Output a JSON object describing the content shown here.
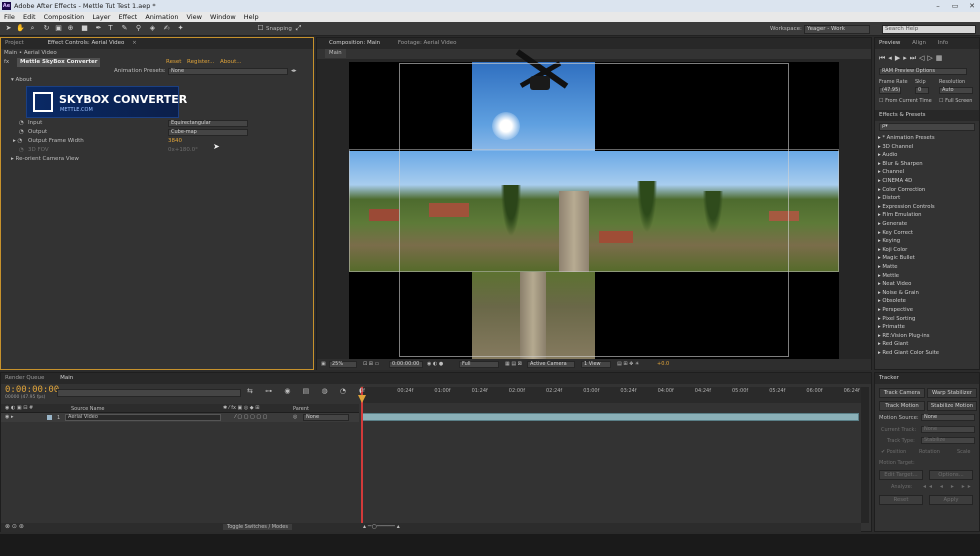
{
  "app": {
    "title": "Adobe After Effects - Mettle Tut Test 1.aep *",
    "logo": "Ae"
  },
  "menu": [
    "File",
    "Edit",
    "Composition",
    "Layer",
    "Effect",
    "Animation",
    "View",
    "Window",
    "Help"
  ],
  "toolbar": {
    "snapping": "Snapping",
    "workspace_label": "Workspace:",
    "workspace_value": "Yeager - Work",
    "search_placeholder": "Search Help"
  },
  "left_panel": {
    "tabs": [
      "Project",
      "Effect Controls: Aerial Video"
    ],
    "breadcrumb": "Main • Aerial Video",
    "effect_name": "Mettle SkyBox Converter",
    "reset": "Reset",
    "register": "Register...",
    "about_link": "About...",
    "animation_presets_label": "Animation Presets:",
    "animation_presets_value": "None",
    "about": "About",
    "logo_text": "SKYBOX CONVERTER",
    "logo_sub": "METTLE.COM",
    "input_label": "Input",
    "input_value": "Equirectangular",
    "output_label": "Output",
    "output_value": "Cube-map",
    "width_label": "Output Frame Width",
    "width_value": "3840",
    "fov_label": "3D FOV",
    "fov_value": "0x+180.0°",
    "camera_label": "Re-orient Camera View"
  },
  "comp_panel": {
    "tabs": [
      "Composition: Main",
      "Footage: Aerial Video"
    ],
    "subtab": "Main",
    "zoom": "25%",
    "timecode": "0:00:00:00",
    "resolution": "Full",
    "camera": "Active Camera",
    "views": "1 View",
    "exposure": "+0.0"
  },
  "right_panel": {
    "tabs": [
      "Preview",
      "Align",
      "Info"
    ],
    "ram_options": "RAM Preview Options",
    "frame_rate_label": "Frame Rate",
    "skip_label": "Skip",
    "resolution_label": "Resolution",
    "frame_rate": "(47.95)",
    "skip": "0",
    "resolution": "Auto",
    "from_current": "From Current Time",
    "full_screen": "Full Screen",
    "effects_tab": "Effects & Presets",
    "search_value": "ρ▾",
    "effects": [
      "* Animation Presets",
      "3D Channel",
      "Audio",
      "Blur & Sharpen",
      "Channel",
      "CINEMA 4D",
      "Color Correction",
      "Distort",
      "Expression Controls",
      "Film Emulation",
      "Generate",
      "Key Correct",
      "Keying",
      "Koji Color",
      "Magic Bullet",
      "Matte",
      "Mettle",
      "Neat Video",
      "Noise & Grain",
      "Obsolete",
      "Perspective",
      "Pixel Sorting",
      "Primatte",
      "RE:Vision Plug-ins",
      "Red Giant",
      "Red Giant Color Suite"
    ]
  },
  "timeline": {
    "tabs": [
      "Render Queue",
      "Main"
    ],
    "timecode": "0:00:00:00",
    "frame_info": "00000 (47.95 fps)",
    "col_source": "Source Name",
    "col_parent": "Parent",
    "layer_num": "1",
    "layer_name": "Aerial Video",
    "parent_value": "None",
    "toggle": "Toggle Switches / Modes",
    "ticks": [
      "0f",
      "00:24f",
      "01:00f",
      "01:24f",
      "02:00f",
      "02:24f",
      "03:00f",
      "03:24f",
      "04:00f",
      "04:24f",
      "05:00f",
      "05:24f",
      "06:00f",
      "06:24f"
    ]
  },
  "tracker": {
    "tab": "Tracker",
    "track_camera": "Track Camera",
    "warp_stabilizer": "Warp Stabilizer",
    "track_motion": "Track Motion",
    "stabilize_motion": "Stabilize Motion",
    "motion_source_label": "Motion Source:",
    "motion_source": "None",
    "current_track_label": "Current Track:",
    "current_track": "None",
    "track_type_label": "Track Type:",
    "track_type": "Stabilize",
    "position": "Position",
    "rotation": "Rotation",
    "scale": "Scale",
    "motion_target": "Motion Target:",
    "edit_target": "Edit Target...",
    "options": "Options...",
    "analyze": "Analyze:",
    "reset": "Reset",
    "apply": "Apply"
  }
}
